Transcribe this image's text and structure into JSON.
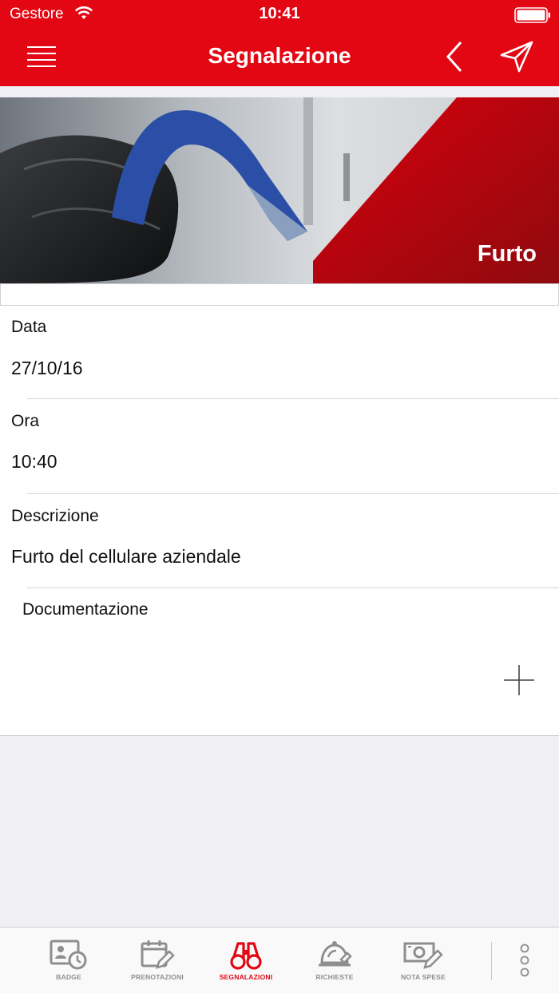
{
  "status_bar": {
    "carrier": "Gestore",
    "time": "10:41"
  },
  "nav": {
    "title": "Segnalazione"
  },
  "hero": {
    "category": "Furto"
  },
  "form": {
    "fields": [
      {
        "label": "Data",
        "value": "27/10/16"
      },
      {
        "label": "Ora",
        "value": "10:40"
      },
      {
        "label": "Descrizione",
        "value": "Furto del cellulare aziendale"
      }
    ],
    "documentation_label": "Documentazione"
  },
  "tabs": [
    {
      "label": "BADGE",
      "icon": "badge-clock-icon",
      "active": false
    },
    {
      "label": "PRENOTAZIONI",
      "icon": "calendar-edit-icon",
      "active": false
    },
    {
      "label": "SEGNALAZIONI",
      "icon": "binoculars-icon",
      "active": true
    },
    {
      "label": "RICHIESTE",
      "icon": "service-bell-icon",
      "active": false
    },
    {
      "label": "NOTA SPESE",
      "icon": "money-edit-icon",
      "active": false
    }
  ],
  "colors": {
    "brand": "#e30613",
    "inactive": "#8e8e8e",
    "background": "#efeff4"
  }
}
